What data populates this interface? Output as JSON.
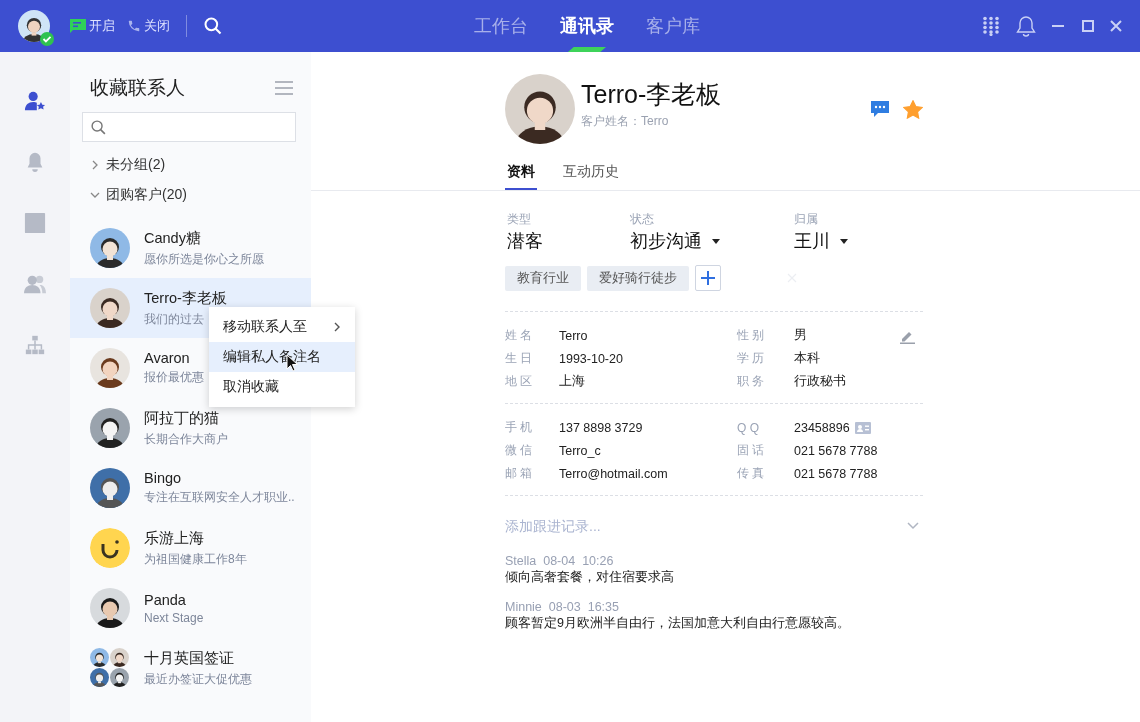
{
  "topbar": {
    "status_items": [
      {
        "kind": "message",
        "label": "开启"
      },
      {
        "kind": "phone",
        "label": "关闭"
      }
    ],
    "tabs": [
      {
        "label": "工作台",
        "selected": false
      },
      {
        "label": "通讯录",
        "selected": true
      },
      {
        "label": "客户库",
        "selected": false
      }
    ]
  },
  "nav_rail": [
    {
      "kind": "favorites",
      "selected": true
    },
    {
      "kind": "bell",
      "selected": false
    },
    {
      "kind": "square",
      "selected": false
    },
    {
      "kind": "people",
      "selected": false
    },
    {
      "kind": "org",
      "selected": false
    }
  ],
  "contacts_panel": {
    "title": "收藏联系人",
    "groups": [
      {
        "label": "未分组(2)",
        "expanded": false
      },
      {
        "label": "团购客户(20)",
        "expanded": true,
        "children": [
          {
            "name": "Candy糖",
            "note": "愿你所选是你心之所愿",
            "selected": false
          },
          {
            "name": "Terro-李老板",
            "note": "我们的过去",
            "selected": true
          },
          {
            "name": "Avaron",
            "note": "报价最优惠",
            "selected": false
          },
          {
            "name": "阿拉丁的猫",
            "note": "长期合作大商户",
            "selected": false
          },
          {
            "name": "Bingo",
            "note": "专注在互联网安全人才职业..",
            "selected": false
          },
          {
            "name": "乐游上海",
            "note": "为祖国健康工作8年",
            "kind": "logo",
            "selected": false
          },
          {
            "name": "Panda",
            "note": "Next Stage",
            "selected": false
          },
          {
            "name": "十月英国签证",
            "note": "最近办签证大促优惠",
            "kind": "group",
            "selected": false
          }
        ]
      }
    ]
  },
  "context_menu": {
    "items": [
      {
        "label": "移动联系人至",
        "submenu": true,
        "selected": false
      },
      {
        "label": "编辑私人备注名",
        "submenu": false,
        "selected": true
      },
      {
        "label": "取消收藏",
        "submenu": false,
        "selected": false
      }
    ]
  },
  "profile": {
    "name": "Terro-李老板",
    "subtitle": "客户姓名：Terro",
    "favorite": true,
    "tabs": [
      {
        "label": "资料",
        "selected": true
      },
      {
        "label": "互动历史",
        "selected": false
      }
    ],
    "summary": [
      {
        "label": "类型",
        "value": "潜客",
        "dropdown": false
      },
      {
        "label": "状态",
        "value": "初步沟通",
        "dropdown": true
      },
      {
        "label": "归属",
        "value": "王川",
        "dropdown": true
      }
    ],
    "tags": [
      "教育行业",
      "爱好骑行徒步"
    ],
    "sections": [
      {
        "rows": [
          {
            "label": "姓 名",
            "value": "Terro"
          },
          {
            "label": "性 别",
            "value": "男"
          },
          {
            "label": "生 日",
            "value": "1993-10-20"
          },
          {
            "label": "学 历",
            "value": "本科"
          },
          {
            "label": "地 区",
            "value": "上海"
          },
          {
            "label": "职 务",
            "value": "行政秘书"
          }
        ]
      },
      {
        "rows": [
          {
            "label": "手 机",
            "value": "137 8898 3729"
          },
          {
            "label": "Q Q",
            "value": "23458896",
            "card": true
          },
          {
            "label": "微 信",
            "value": "Terro_c"
          },
          {
            "label": "固 话",
            "value": "021 5678 7788"
          },
          {
            "label": "邮 箱",
            "value": "Terro@hotmail.com"
          },
          {
            "label": "传 真",
            "value": "021 5678 7788"
          }
        ]
      }
    ],
    "followup": {
      "placeholder": "添加跟进记录...",
      "records": [
        {
          "author": "Stella",
          "date": "08-04",
          "time": "10:26",
          "text": "倾向高奢套餐，对住宿要求高"
        },
        {
          "author": "Minnie",
          "date": "08-03",
          "time": "16:35",
          "text": "顾客暂定9月欧洲半自由行，法国加意大利自由行意愿较高。"
        }
      ]
    }
  }
}
